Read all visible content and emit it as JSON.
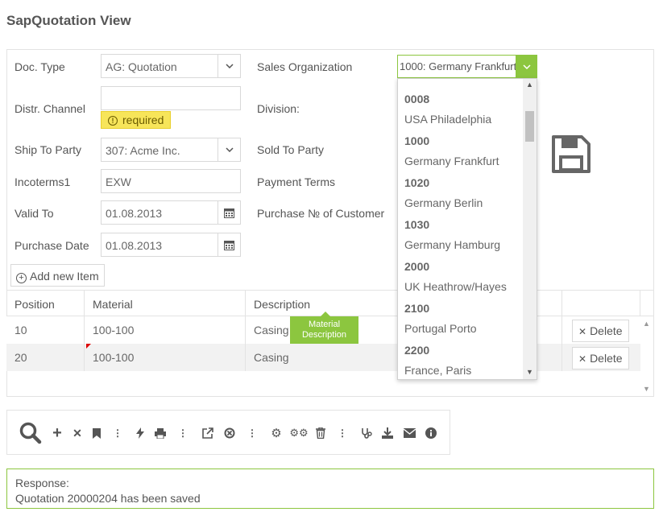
{
  "page": {
    "title": "SapQuotation View"
  },
  "form": {
    "doc_type_label": "Doc. Type",
    "doc_type_value": "AG: Quotation",
    "distr_channel_label": "Distr. Channel",
    "distr_channel_value": "",
    "required_text": "required",
    "ship_to_label": "Ship To Party",
    "ship_to_value": "307: Acme Inc.",
    "incoterms_label": "Incoterms1",
    "incoterms_value": "EXW",
    "valid_to_label": "Valid To",
    "valid_to_value": "01.08.2013",
    "purchase_date_label": "Purchase Date",
    "purchase_date_value": "01.08.2013",
    "sales_org_label": "Sales Organization",
    "sales_org_value": "1000: Germany Frankfurt",
    "division_label": "Division:",
    "sold_to_label": "Sold To Party",
    "payment_terms_label": "Payment Terms",
    "purchase_no_label": "Purchase № of Customer"
  },
  "dropdown": {
    "items": [
      {
        "code": "0008",
        "name": "USA Philadelphia"
      },
      {
        "code": "1000",
        "name": "Germany Frankfurt"
      },
      {
        "code": "1020",
        "name": "Germany Berlin"
      },
      {
        "code": "1030",
        "name": "Germany Hamburg"
      },
      {
        "code": "2000",
        "name": "UK Heathrow/Hayes"
      },
      {
        "code": "2100",
        "name": "Portugal Porto"
      },
      {
        "code": "2200",
        "name": "France, Paris"
      }
    ]
  },
  "grid": {
    "add_item_label": "Add new Item",
    "columns": [
      "Position",
      "Material",
      "Description"
    ],
    "rows": [
      {
        "position": "10",
        "material": "100-100",
        "description": "Casing"
      },
      {
        "position": "20",
        "material": "100-100",
        "description": "Casing"
      }
    ],
    "delete_label": "Delete",
    "tooltip": "Material Description"
  },
  "response": {
    "label": "Response:",
    "message": "Quotation 20000204 has been saved"
  },
  "colors": {
    "accent": "#8cc63f",
    "required_bg": "#f7e55a"
  },
  "icons": [
    "search-icon",
    "plus-icon",
    "close-icon",
    "bookmark-icon",
    "more-icon",
    "lightning-icon",
    "print-icon",
    "external-link-icon",
    "cancel-circle-icon",
    "gear-icon",
    "gears-icon",
    "trash-icon",
    "stethoscope-icon",
    "download-icon",
    "envelope-icon",
    "info-icon",
    "save-icon",
    "calendar-icon",
    "chevron-down-icon"
  ]
}
